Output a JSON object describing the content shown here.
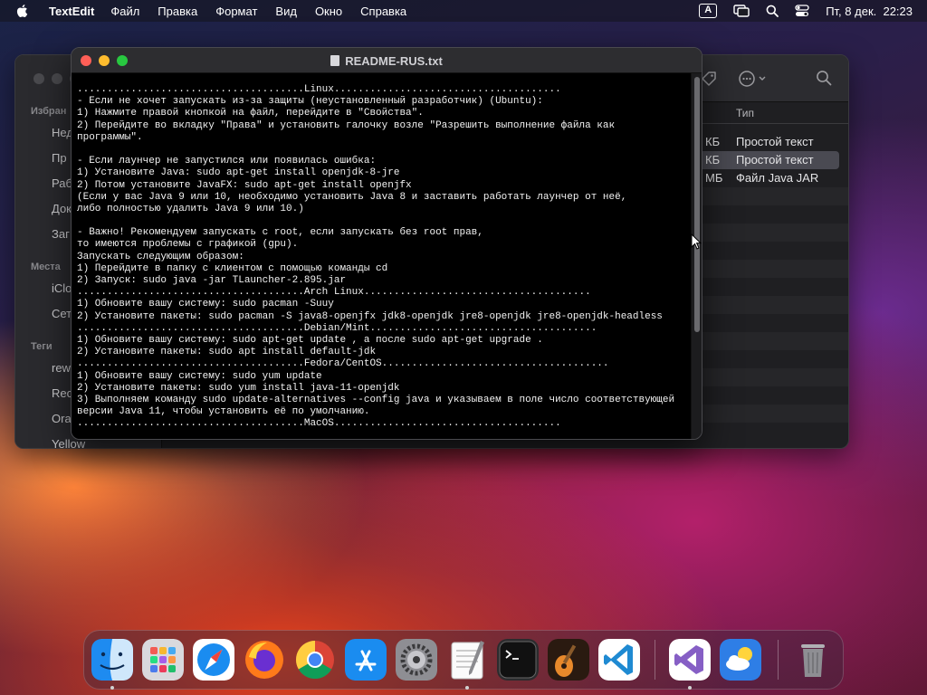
{
  "menubar": {
    "app_name": "TextEdit",
    "menus": [
      "Файл",
      "Правка",
      "Формат",
      "Вид",
      "Окно",
      "Справка"
    ],
    "input_source": "A",
    "datetime": "Пт, 8 дек.  22:23"
  },
  "finder": {
    "sidebar_favorites_header": "Избран",
    "favorites": [
      "Нед",
      "Пр",
      "Раб",
      "Док",
      "Заг"
    ],
    "sidebar_places_header": "Места",
    "places": [
      "iClo",
      "Сет"
    ],
    "sidebar_tags_header": "Теги",
    "tags": [
      "rewa",
      "Rec",
      "Ora",
      "Yellow"
    ],
    "type_column_header": "Тип",
    "rows": [
      {
        "size_unit": "КБ",
        "type": "Простой текст"
      },
      {
        "size_unit": "КБ",
        "type": "Простой текст"
      },
      {
        "size_unit": "МБ",
        "type": "Файл Java JAR"
      }
    ]
  },
  "textedit": {
    "title": "README-RUS.txt",
    "lines": [
      "......................................Linux......................................",
      "- Если не хочет запускать из-за защиты (неустановленный разработчик) (Ubuntu):",
      "1) Нажмите правой кнопкой на файл, перейдите в \"Свойства\".",
      "2) Перейдите во вкладку \"Права\" и установить галочку возле \"Разрешить выполнение файла как",
      "программы\".",
      "",
      "- Если лаунчер не запустился или появилась ошибка:",
      "1) Установите Java: sudo apt-get install openjdk-8-jre",
      "2) Потом установите JavaFX: sudo apt-get install openjfx",
      "(Если у вас Java 9 или 10, необходимо установить Java 8 и заставить работать лаунчер от неё,",
      "либо полностью удалить Java 9 или 10.)",
      "",
      "- Важно! Рекомендуем запускать с root, если запускать без root прав,",
      "то имеются проблемы с графикой (gpu).",
      "Запускать следующим образом:",
      "1) Перейдите в папку с клиентом с помощью команды cd",
      "2) Запуск: sudo java -jar TLauncher-2.895.jar",
      "......................................Arch Linux......................................",
      "1) Обновите вашу систему: sudo pacman -Suuy",
      "2) Установите пакеты: sudo pacman -S java8-openjfx jdk8-openjdk jre8-openjdk jre8-openjdk-headless",
      "......................................Debian/Mint......................................",
      "1) Обновите вашу систему: sudo apt-get update , а после sudo apt-get upgrade .",
      "2) Установите пакеты: sudo apt install default-jdk",
      "......................................Fedora/CentOS......................................",
      "1) Обновите вашу систему: sudo yum update",
      "2) Установите пакеты: sudo yum install java-11-openjdk",
      "3) Выполняем команду sudo update-alternatives --config java и указываем в поле число соответствующей",
      "версии Java 11, чтобы установить её по умолчанию.",
      "......................................MacOS......................................"
    ]
  },
  "dock": {
    "apps": [
      "Finder",
      "Launchpad",
      "Safari",
      "Firefox",
      "Chrome",
      "App Store",
      "System Settings",
      "TextEdit",
      "Terminal",
      "GarageBand",
      "Visual Studio Code",
      "Visual Studio",
      "Weather",
      "Trash"
    ]
  },
  "colors": {
    "close": "#ff5f57",
    "minimize": "#febc2e",
    "zoom": "#28c840",
    "editor_bg": "#000000",
    "editor_text": "#f2f2f2"
  }
}
